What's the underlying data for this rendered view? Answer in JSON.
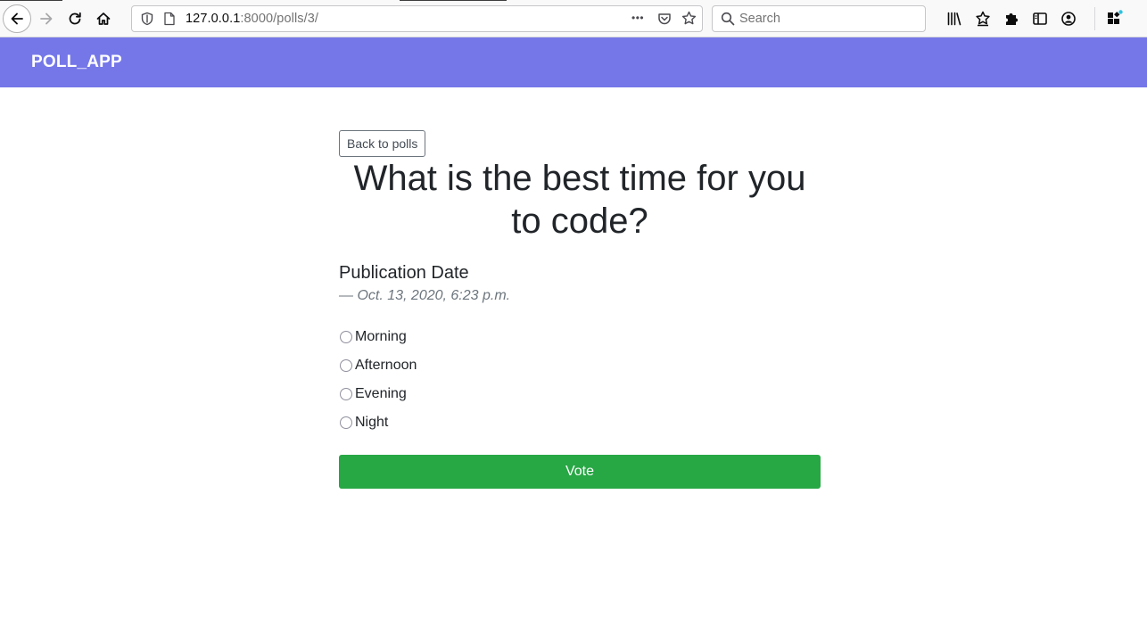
{
  "browser": {
    "url_host": "127.0.0.1",
    "url_path": ":8000/polls/3/",
    "search_placeholder": "Search",
    "page_actions_glyph": "•••"
  },
  "navbar": {
    "brand": "POLL_APP",
    "color": "#7577e8"
  },
  "poll": {
    "back_label": "Back to polls",
    "question_line1": "What is the best time for you",
    "question_line2": "to code?",
    "pub_label": "Publication Date",
    "pub_date": "— Oct. 13, 2020, 6:23 p.m.",
    "choices": [
      "Morning",
      "Afternoon",
      "Evening",
      "Night"
    ],
    "vote_label": "Vote",
    "vote_color": "#28a745"
  },
  "icons": [
    "back-arrow-icon",
    "forward-arrow-icon",
    "reload-icon",
    "home-icon",
    "shield-icon",
    "page-icon",
    "more-icon",
    "pocket-icon",
    "bookmark-star-icon",
    "search-icon",
    "library-icon",
    "bookmarks-icon",
    "extensions-icon",
    "sidebar-icon",
    "account-icon",
    "customize-icon"
  ]
}
